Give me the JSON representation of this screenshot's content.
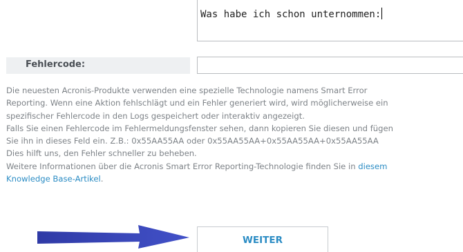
{
  "form": {
    "notes_field": {
      "value": "Was habe ich schon unternommen:"
    },
    "error_code": {
      "label": "Fehlercode:",
      "value": ""
    }
  },
  "description": {
    "lines": [
      "Die neuesten Acronis-Produkte verwenden eine spezielle Technologie namens Smart Error",
      "Reporting. Wenn eine Aktion fehlschlägt und ein Fehler generiert wird, wird möglicherweise ein",
      "spezifischer Fehlercode in den Logs gespeichert oder interaktiv angezeigt.",
      "Falls Sie einen Fehlercode im Fehlermeldungsfenster sehen, dann kopieren Sie diesen und fügen",
      "Sie ihn in dieses Feld ein. Z.B.: 0x55AA55AA oder 0x55AA55AA+0x55AA55AA+0x55AA55AA",
      "Dies hilft uns, den Fehler schneller zu beheben."
    ],
    "kb_prefix": "Weitere Informationen über die Acronis Smart Error Reporting-Technologie finden Sie in ",
    "kb_link_part1": "diesem",
    "kb_link_part2": "Knowledge Base-Artikel",
    "kb_suffix": "."
  },
  "actions": {
    "continue_label": "WEITER"
  },
  "annotation": {
    "arrow_icon": "arrow-right-icon",
    "arrow_color": "#3a47b8"
  },
  "colors": {
    "link": "#2b8cc4",
    "body_text": "#7d8287",
    "label_bg": "#eef0f2"
  }
}
